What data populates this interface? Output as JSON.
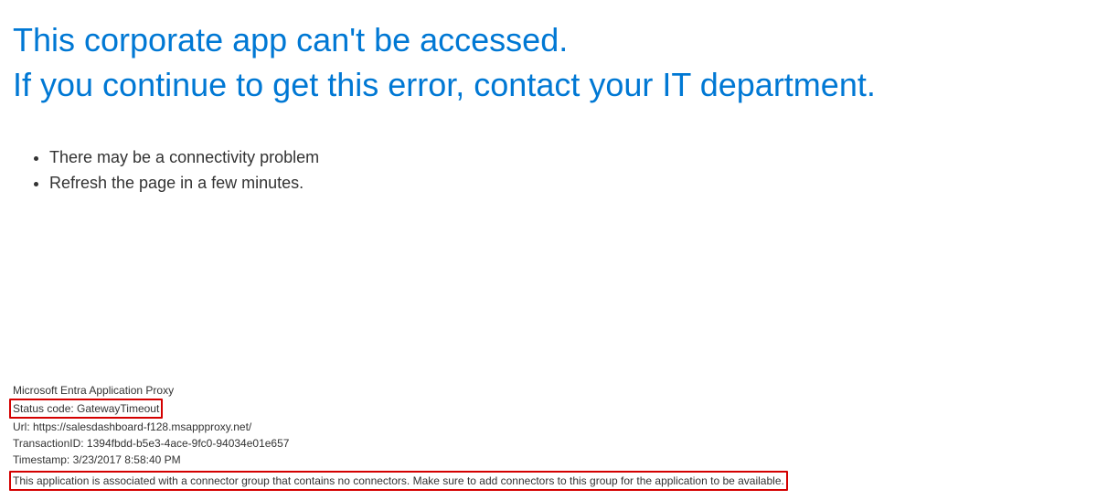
{
  "heading": {
    "line1": "This corporate app can't be accessed.",
    "line2": "If you continue to get this error, contact your IT department."
  },
  "bullets": {
    "item1": "There may be a connectivity problem",
    "item2": "Refresh the page in a few minutes."
  },
  "footer": {
    "product": "Microsoft Entra Application Proxy",
    "status_code_line": "Status code: GatewayTimeout",
    "url_line": "Url: https://salesdashboard-f128.msappproxy.net/",
    "transaction_line": "TransactionID: 1394fbdd-b5e3-4ace-9fc0-94034e01e657",
    "timestamp_line": "Timestamp: 3/23/2017 8:58:40 PM",
    "message": "This application is associated with a connector group that contains no connectors. Make sure to add connectors to this group for the application to be available."
  }
}
